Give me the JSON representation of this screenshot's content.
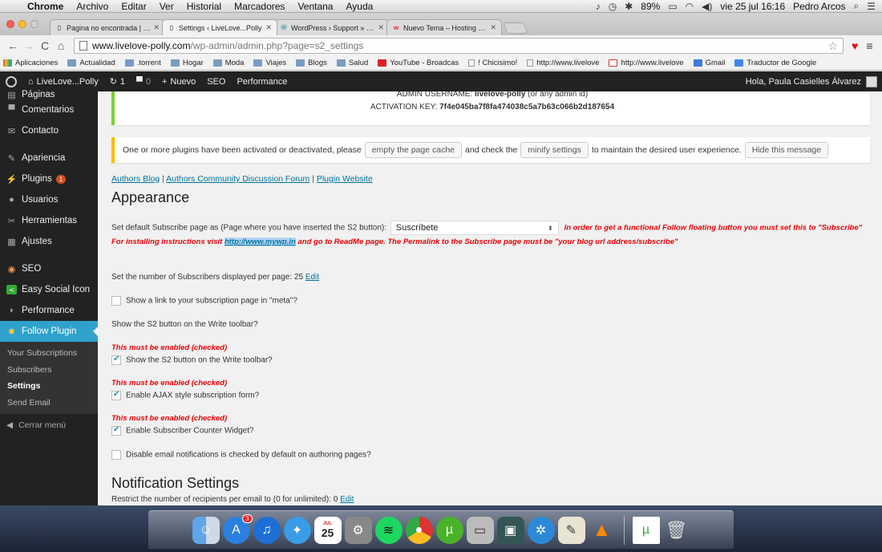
{
  "menubar": {
    "app": "Chrome",
    "items": [
      "Archivo",
      "Editar",
      "Ver",
      "Historial",
      "Marcadores",
      "Ventana",
      "Ayuda"
    ],
    "battery": "89%",
    "clock": "vie 25 jul  16:16",
    "user": "Pedro Arcos"
  },
  "tabs": [
    {
      "title": "Pagina no encontrada | Liv",
      "active": false
    },
    {
      "title": "Settings ‹ LiveLove...Polly",
      "active": true
    },
    {
      "title": "WordPress › Support » Pop",
      "active": false
    },
    {
      "title": "Nuevo Tema – Hosting We",
      "active": false
    }
  ],
  "address": {
    "host": "www.livelove-polly.com",
    "path": "/wp-admin/admin.php?page=s2_settings"
  },
  "bookmarks": [
    "Aplicaciones",
    "Actualidad",
    ".torrent",
    "Hogar",
    "Moda",
    "Viajes",
    "Blogs",
    "Salud",
    "YouTube - Broadcas",
    "! Chicisimo!",
    "http://www.livelove",
    "http://www.livelove",
    "Gmail",
    "Traductor de Google"
  ],
  "adminbar": {
    "site": "LiveLove...Polly",
    "updates": "1",
    "comments": "0",
    "new": "Nuevo",
    "seo": "SEO",
    "performance": "Performance",
    "greeting": "Hola, Paula Casielles Álvarez"
  },
  "sidebar": {
    "items": [
      {
        "label": "Páginas",
        "icon": "pages-icon"
      },
      {
        "label": "Comentarios",
        "icon": "comments-icon"
      },
      {
        "label": "Contacto",
        "icon": "contact-icon"
      },
      {
        "label": "Apariencia",
        "icon": "appearance-icon"
      },
      {
        "label": "Plugins",
        "icon": "plugins-icon",
        "badge": "1"
      },
      {
        "label": "Usuarios",
        "icon": "users-icon"
      },
      {
        "label": "Herramientas",
        "icon": "tools-icon"
      },
      {
        "label": "Ajustes",
        "icon": "settings-icon"
      },
      {
        "label": "SEO",
        "icon": "seo-icon"
      },
      {
        "label": "Easy Social Icon",
        "icon": "social-icon"
      },
      {
        "label": "Performance",
        "icon": "performance-icon"
      },
      {
        "label": "Follow Plugin",
        "icon": "follow-icon"
      }
    ],
    "submenu": [
      "Your Subscriptions",
      "Subscribers",
      "Settings",
      "Send Email"
    ],
    "collapse": "Cerrar menú"
  },
  "notice1": {
    "line1_label": "ADMIN USERNAME:",
    "line1_value": "livelove-polly",
    "line1_suffix": "(or any admin id)",
    "line2_label": "ACTIVATION KEY:",
    "line2_value": "7f4e045ba7f8fa474038c5a7b63c066b2d187654"
  },
  "notice2": {
    "text1": "One or more plugins have been activated or deactivated, please",
    "btn1": "empty the page cache",
    "text2": "and check the",
    "btn2": "minify settings",
    "text3": "to maintain the desired user experience.",
    "btn3": "Hide this message"
  },
  "links": {
    "a": "Authors Blog",
    "b": "Authors Community Discussion Forum",
    "c": "Plugin Website"
  },
  "appearance": {
    "heading": "Appearance",
    "subscribe_label": "Set default Subscribe page as (Page where you have inserted the S2 button):",
    "subscribe_value": "Suscríbete",
    "subscribe_warning": "In order to get a functional Follow floating button you must set this to \"Subscribe\"",
    "install_prefix": "For installing instructions visit",
    "install_link": "http://www.mywp.in",
    "install_suffix": "and go to ReadMe page. The Permalink to the Subscribe page must be \"your blog url address/subscribe\"",
    "subscribers_label": "Set the number of Subscribers displayed per page:",
    "subscribers_value": "25",
    "edit": "Edit",
    "meta_link": "Show a link to your subscription page in \"meta\"?",
    "s2_toolbar_q": "Show the S2 button on the Write toolbar?",
    "must": "This must be enabled (checked)",
    "s2_toolbar": "Show the S2 button on the Write toolbar?",
    "ajax": "Enable AJAX style subscription form?",
    "counter": "Enable Subscriber Counter Widget?",
    "disable_email": "Disable email notifications is checked by default on authoring pages?"
  },
  "notifications": {
    "heading": "Notification Settings",
    "restrict_label": "Restrict the number of recipients per email to (0 for unlimited):",
    "restrict_value": "0",
    "edit": "Edit"
  },
  "dock": {
    "appstore_badge": "3",
    "calendar_day": "25",
    "calendar_month": "JUL"
  }
}
